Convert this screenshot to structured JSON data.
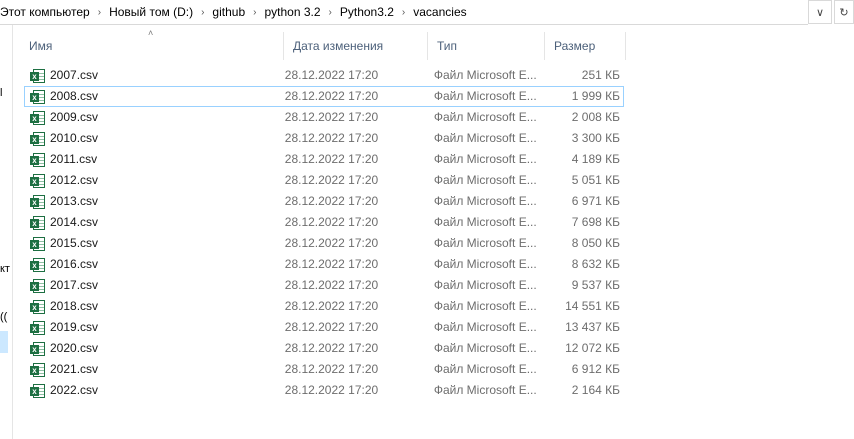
{
  "breadcrumb": [
    "Этот компьютер",
    "Новый том (D:)",
    "github",
    "python 3.2",
    "Python3.2",
    "vacancies"
  ],
  "left_fragments": [
    "l",
    "кт",
    "(("
  ],
  "columns": {
    "name": "Имя",
    "date": "Дата изменения",
    "type": "Тип",
    "size": "Размер"
  },
  "files": [
    {
      "name": "2007.csv",
      "date": "28.12.2022 17:20",
      "type": "Файл Microsoft E...",
      "size": "251 КБ"
    },
    {
      "name": "2008.csv",
      "date": "28.12.2022 17:20",
      "type": "Файл Microsoft E...",
      "size": "1 999 КБ"
    },
    {
      "name": "2009.csv",
      "date": "28.12.2022 17:20",
      "type": "Файл Microsoft E...",
      "size": "2 008 КБ"
    },
    {
      "name": "2010.csv",
      "date": "28.12.2022 17:20",
      "type": "Файл Microsoft E...",
      "size": "3 300 КБ"
    },
    {
      "name": "2011.csv",
      "date": "28.12.2022 17:20",
      "type": "Файл Microsoft E...",
      "size": "4 189 КБ"
    },
    {
      "name": "2012.csv",
      "date": "28.12.2022 17:20",
      "type": "Файл Microsoft E...",
      "size": "5 051 КБ"
    },
    {
      "name": "2013.csv",
      "date": "28.12.2022 17:20",
      "type": "Файл Microsoft E...",
      "size": "6 971 КБ"
    },
    {
      "name": "2014.csv",
      "date": "28.12.2022 17:20",
      "type": "Файл Microsoft E...",
      "size": "7 698 КБ"
    },
    {
      "name": "2015.csv",
      "date": "28.12.2022 17:20",
      "type": "Файл Microsoft E...",
      "size": "8 050 КБ"
    },
    {
      "name": "2016.csv",
      "date": "28.12.2022 17:20",
      "type": "Файл Microsoft E...",
      "size": "8 632 КБ"
    },
    {
      "name": "2017.csv",
      "date": "28.12.2022 17:20",
      "type": "Файл Microsoft E...",
      "size": "9 537 КБ"
    },
    {
      "name": "2018.csv",
      "date": "28.12.2022 17:20",
      "type": "Файл Microsoft E...",
      "size": "14 551 КБ"
    },
    {
      "name": "2019.csv",
      "date": "28.12.2022 17:20",
      "type": "Файл Microsoft E...",
      "size": "13 437 КБ"
    },
    {
      "name": "2020.csv",
      "date": "28.12.2022 17:20",
      "type": "Файл Microsoft E...",
      "size": "12 072 КБ"
    },
    {
      "name": "2021.csv",
      "date": "28.12.2022 17:20",
      "type": "Файл Microsoft E...",
      "size": "6 912 КБ"
    },
    {
      "name": "2022.csv",
      "date": "28.12.2022 17:20",
      "type": "Файл Microsoft E...",
      "size": "2 164 КБ"
    }
  ],
  "focused_row": 1,
  "icons": {
    "file": "excel-csv-file-icon",
    "separator": "chevron-right-icon",
    "sort": "sort-ascending-icon"
  },
  "colors": {
    "header_text": "#4c607a",
    "focus_border": "#99d1ff",
    "excel_green": "#1d6f42"
  }
}
